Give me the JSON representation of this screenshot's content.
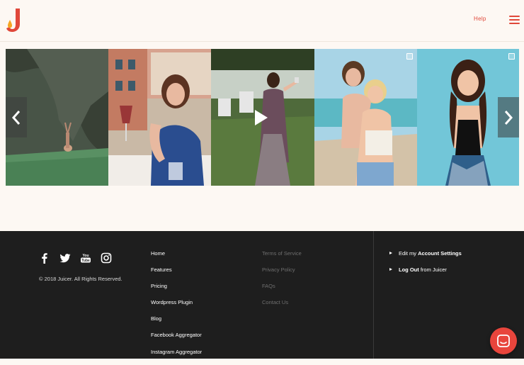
{
  "header": {
    "help_label": "Help"
  },
  "colors": {
    "accent": "#e0483a",
    "footer_bg": "#1e1e1e",
    "page_bg": "#fdf8f3"
  },
  "carousel": {
    "tiles": [
      {
        "kind": "photo",
        "has_play": false,
        "has_check": false
      },
      {
        "kind": "photo",
        "has_play": false,
        "has_check": false
      },
      {
        "kind": "video",
        "has_play": true,
        "has_check": false
      },
      {
        "kind": "photo",
        "has_play": false,
        "has_check": true
      },
      {
        "kind": "photo",
        "has_play": false,
        "has_check": true
      }
    ],
    "prev_icon": "chevron-left-icon",
    "next_icon": "chevron-right-icon"
  },
  "footer": {
    "social": [
      "facebook-icon",
      "twitter-icon",
      "youtube-icon",
      "instagram-icon"
    ],
    "copyright": "© 2018 Juicer. All Rights Reserved.",
    "primary_links": [
      "Home",
      "Features",
      "Pricing",
      "Wordpress Plugin",
      "Blog",
      "Facebook Aggregator",
      "Instagram Aggregator"
    ],
    "secondary_links": [
      "Terms of Service",
      "Privacy Policy",
      "FAQs",
      "Contact Us"
    ],
    "account": {
      "edit_prefix": "Edit my",
      "edit_bold": "Account Settings",
      "logout_bold": "Log Out",
      "logout_suffix": "from Juicer"
    }
  }
}
